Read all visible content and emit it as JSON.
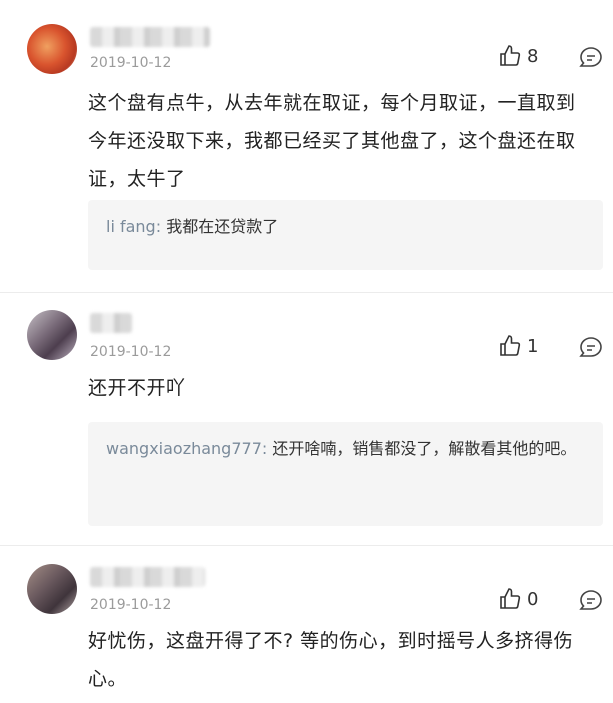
{
  "comments": [
    {
      "date": "2019-10-12",
      "likes": "8",
      "text": "这个盘有点牛，从去年就在取证，每个月取证，一直取到今年还没取下来，我都已经买了其他盘了，这个盘还在取证，太牛了",
      "reply": {
        "user": "li fang:",
        "text": "我都在还贷款了"
      }
    },
    {
      "date": "2019-10-12",
      "likes": "1",
      "text": "还开不开吖",
      "reply": {
        "user": "wangxiaozhang777:",
        "text": "还开啥喃，销售都没了，解散看其他的吧。"
      }
    },
    {
      "date": "2019-10-12",
      "likes": "0",
      "text": "好忧伤，这盘开得了不? 等的伤心，到时摇号人多挤得伤心。",
      "reply": null
    }
  ],
  "icons": {
    "like": "thumbs-up-icon",
    "reply": "reply-bubble-icon"
  }
}
